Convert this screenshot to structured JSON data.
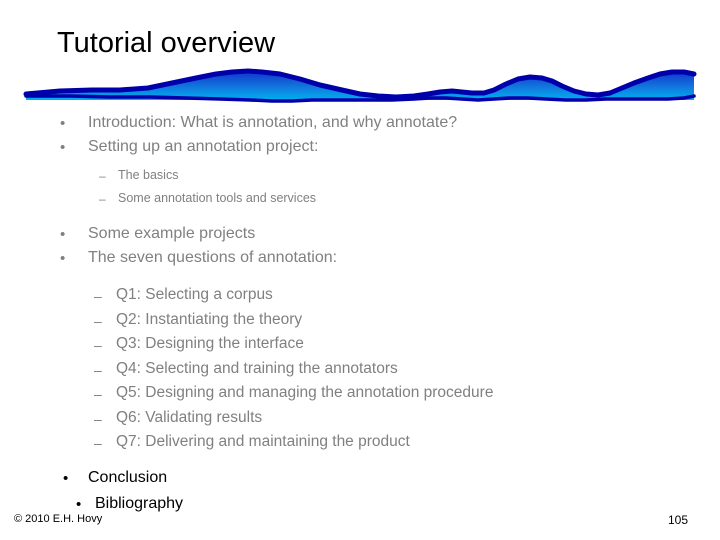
{
  "slide": {
    "title": "Tutorial overview",
    "page_number": "105",
    "copyright": "© 2010  E.H. Hovy",
    "colors": {
      "title_text": "#000000",
      "body_text_gray": "#808080",
      "closing_text": "#000000",
      "wave_stroke": "#0000AA",
      "wave_fill_light": "#00A0E0",
      "wave_fill_dark": "#0033CC",
      "background": "#FFFFFF"
    },
    "outline": [
      {
        "level": "1",
        "marker": "•",
        "text": "Introduction: What is annotation, and why annotate?"
      },
      {
        "level": "1",
        "marker": "•",
        "text": "Setting up an annotation project:"
      },
      {
        "level": "2small",
        "marker": "–",
        "text": "The basics"
      },
      {
        "level": "2small",
        "marker": "–",
        "text": "Some annotation tools and services"
      },
      {
        "level": "1",
        "marker": "•",
        "text": "Some example projects"
      },
      {
        "level": "1",
        "marker": "•",
        "text": "The seven questions of annotation:"
      },
      {
        "level": "2large",
        "marker": "–",
        "text": "Q1: Selecting a corpus"
      },
      {
        "level": "2large",
        "marker": "–",
        "text": "Q2: Instantiating the theory"
      },
      {
        "level": "2large",
        "marker": "–",
        "text": "Q3: Designing the interface"
      },
      {
        "level": "2large",
        "marker": "–",
        "text": "Q4: Selecting and training the annotators"
      },
      {
        "level": "2large",
        "marker": "–",
        "text": "Q5: Designing and managing the annotation procedure"
      },
      {
        "level": "2large",
        "marker": "–",
        "text": "Q6: Validating results"
      },
      {
        "level": "2large",
        "marker": "–",
        "text": "Q7: Delivering and maintaining the product"
      },
      {
        "level": "close-a",
        "marker": "•",
        "text": "Conclusion"
      },
      {
        "level": "close-b",
        "marker": "•",
        "text": "Bibliography"
      }
    ]
  }
}
